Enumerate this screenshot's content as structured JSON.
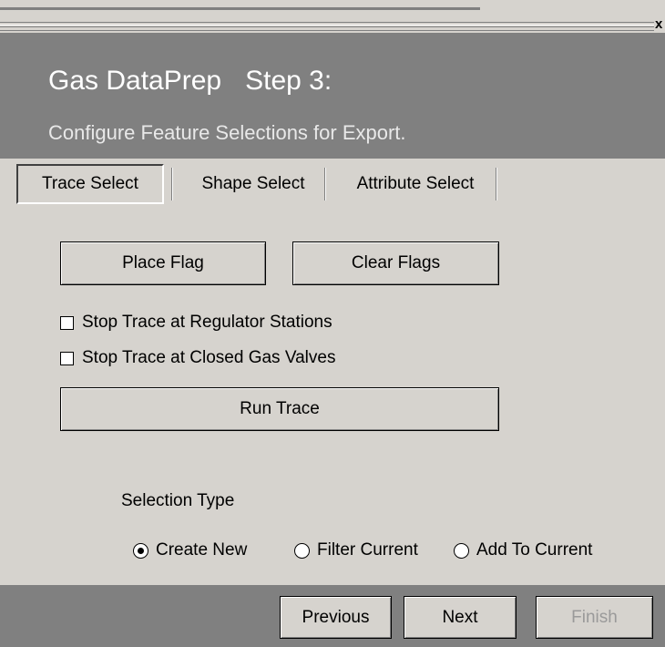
{
  "window": {
    "close_glyph": "x"
  },
  "header": {
    "title": "Gas DataPrep",
    "step": "Step 3:",
    "subtitle": "Configure Feature Selections for Export."
  },
  "tabs": [
    {
      "label": "Trace Select",
      "active": true
    },
    {
      "label": "Shape Select",
      "active": false
    },
    {
      "label": "Attribute Select",
      "active": false
    }
  ],
  "trace": {
    "place_flag_label": "Place Flag",
    "clear_flags_label": "Clear Flags",
    "options": [
      {
        "label": "Stop Trace at Regulator Stations",
        "checked": false
      },
      {
        "label": "Stop Trace at Closed Gas Valves",
        "checked": false
      }
    ],
    "run_trace_label": "Run Trace"
  },
  "selection": {
    "label": "Selection Type",
    "options": [
      {
        "label": "Create New",
        "selected": true
      },
      {
        "label": "Filter Current",
        "selected": false
      },
      {
        "label": "Add To Current",
        "selected": false
      }
    ]
  },
  "footer": {
    "previous_label": "Previous",
    "next_label": "Next",
    "finish_label": "Finish",
    "finish_enabled": false
  },
  "colors": {
    "header_bg": "#808080",
    "panel_bg": "#d6d3ce",
    "disabled_text": "#9a9a9a"
  }
}
